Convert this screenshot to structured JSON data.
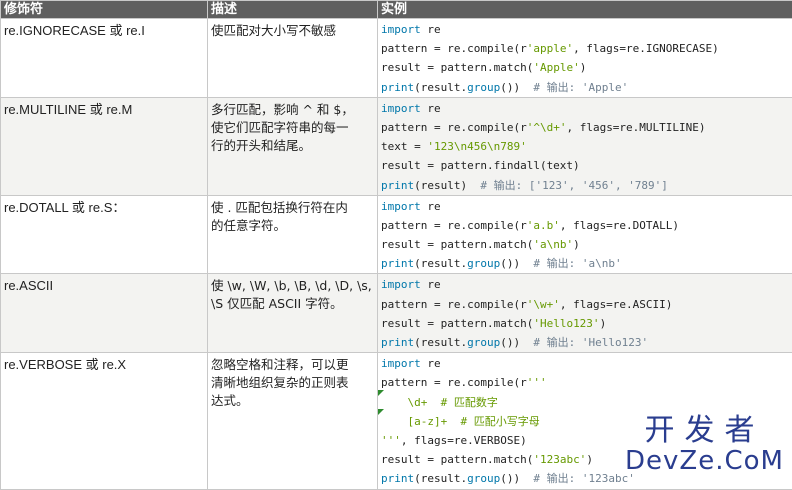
{
  "headers": {
    "flag": "修饰符",
    "desc": "描述",
    "example": "实例"
  },
  "rows": [
    {
      "flag": "re.IGNORECASE 或 re.I",
      "desc": [
        "使匹配对大小写不敏感"
      ],
      "code": [
        [
          {
            "t": "import",
            "c": "kw"
          },
          {
            "t": " re"
          }
        ],
        [
          {
            "t": "pattern = re.compile(r"
          },
          {
            "t": "'apple'",
            "c": "str"
          },
          {
            "t": ", flags=re.IGNORECASE)"
          }
        ],
        [
          {
            "t": "result = pattern.match("
          },
          {
            "t": "'Apple'",
            "c": "str"
          },
          {
            "t": ")"
          }
        ],
        [
          {
            "t": "print",
            "c": "fn"
          },
          {
            "t": "(result."
          },
          {
            "t": "group",
            "c": "fn"
          },
          {
            "t": "())  "
          },
          {
            "t": "# 输出: 'Apple'",
            "c": "cm"
          }
        ]
      ]
    },
    {
      "flag": "re.MULTILINE 或 re.M",
      "desc": [
        "多行匹配，影响 ^ 和 $，",
        "使它们匹配字符串的每一",
        "行的开头和结尾。"
      ],
      "code": [
        [
          {
            "t": "import",
            "c": "kw"
          },
          {
            "t": " re"
          }
        ],
        [
          {
            "t": "pattern = re.compile(r"
          },
          {
            "t": "'^\\d+'",
            "c": "str"
          },
          {
            "t": ", flags=re.MULTILINE)"
          }
        ],
        [
          {
            "t": "text = "
          },
          {
            "t": "'123\\n456\\n789'",
            "c": "str"
          }
        ],
        [
          {
            "t": "result = pattern.findall(text)"
          }
        ],
        [
          {
            "t": "print",
            "c": "fn"
          },
          {
            "t": "(result)  "
          },
          {
            "t": "# 输出: ['123', '456', '789']",
            "c": "cm"
          }
        ]
      ]
    },
    {
      "flag": "re.DOTALL 或 re.S：",
      "desc": [
        "使 . 匹配包括换行符在内",
        "的任意字符。"
      ],
      "code": [
        [
          {
            "t": "import",
            "c": "kw"
          },
          {
            "t": " re"
          }
        ],
        [
          {
            "t": "pattern = re.compile(r"
          },
          {
            "t": "'a.b'",
            "c": "str"
          },
          {
            "t": ", flags=re.DOTALL)"
          }
        ],
        [
          {
            "t": "result = pattern.match("
          },
          {
            "t": "'a\\nb'",
            "c": "str"
          },
          {
            "t": ")"
          }
        ],
        [
          {
            "t": "print",
            "c": "fn"
          },
          {
            "t": "(result."
          },
          {
            "t": "group",
            "c": "fn"
          },
          {
            "t": "())  "
          },
          {
            "t": "# 输出: 'a\\nb'",
            "c": "cm"
          }
        ]
      ]
    },
    {
      "flag": "re.ASCII",
      "desc": [
        "使 \\w, \\W, \\b, \\B, \\d, \\D, \\s,",
        "\\S 仅匹配 ASCII 字符。"
      ],
      "code": [
        [
          {
            "t": "import",
            "c": "kw"
          },
          {
            "t": " re"
          }
        ],
        [
          {
            "t": "pattern = re.compile(r"
          },
          {
            "t": "'\\w+'",
            "c": "str"
          },
          {
            "t": ", flags=re.ASCII)"
          }
        ],
        [
          {
            "t": "result = pattern.match("
          },
          {
            "t": "'Hello123'",
            "c": "str"
          },
          {
            "t": ")"
          }
        ],
        [
          {
            "t": "print",
            "c": "fn"
          },
          {
            "t": "(result."
          },
          {
            "t": "group",
            "c": "fn"
          },
          {
            "t": "())  "
          },
          {
            "t": "# 输出: 'Hello123'",
            "c": "cm"
          }
        ]
      ]
    },
    {
      "flag": "re.VERBOSE 或 re.X",
      "desc": [
        "忽略空格和注释，可以更",
        "清晰地组织复杂的正则表",
        "达式。"
      ],
      "code": [
        [
          {
            "t": "import",
            "c": "kw"
          },
          {
            "t": " re"
          }
        ],
        [
          {
            "t": "pattern = re.compile(r"
          },
          {
            "t": "'''",
            "c": "str"
          }
        ],
        [
          {
            "t": "    \\d+  ",
            "c": "str"
          },
          {
            "t": "# 匹配数字",
            "c": "str"
          }
        ],
        [
          {
            "t": "    [a-z]+  ",
            "c": "str"
          },
          {
            "t": "# 匹配小写字母",
            "c": "str"
          }
        ],
        [
          {
            "t": "'''",
            "c": "str"
          },
          {
            "t": ", flags=re.VERBOSE)"
          }
        ],
        [
          {
            "t": "result = pattern.match("
          },
          {
            "t": "'123abc'",
            "c": "str"
          },
          {
            "t": ")"
          }
        ],
        [
          {
            "t": "print",
            "c": "fn"
          },
          {
            "t": "(result."
          },
          {
            "t": "group",
            "c": "fn"
          },
          {
            "t": "())  "
          },
          {
            "t": "# 输出: '123abc'",
            "c": "cm"
          }
        ]
      ]
    }
  ],
  "watermark": {
    "cn": "开发者",
    "en": "DevZe.CoM"
  },
  "colors": {
    "header_bg": "#5f5f5f",
    "keyword": "#0077aa",
    "string": "#669900",
    "comment": "#708090",
    "watermark": "#2a3d8f"
  }
}
